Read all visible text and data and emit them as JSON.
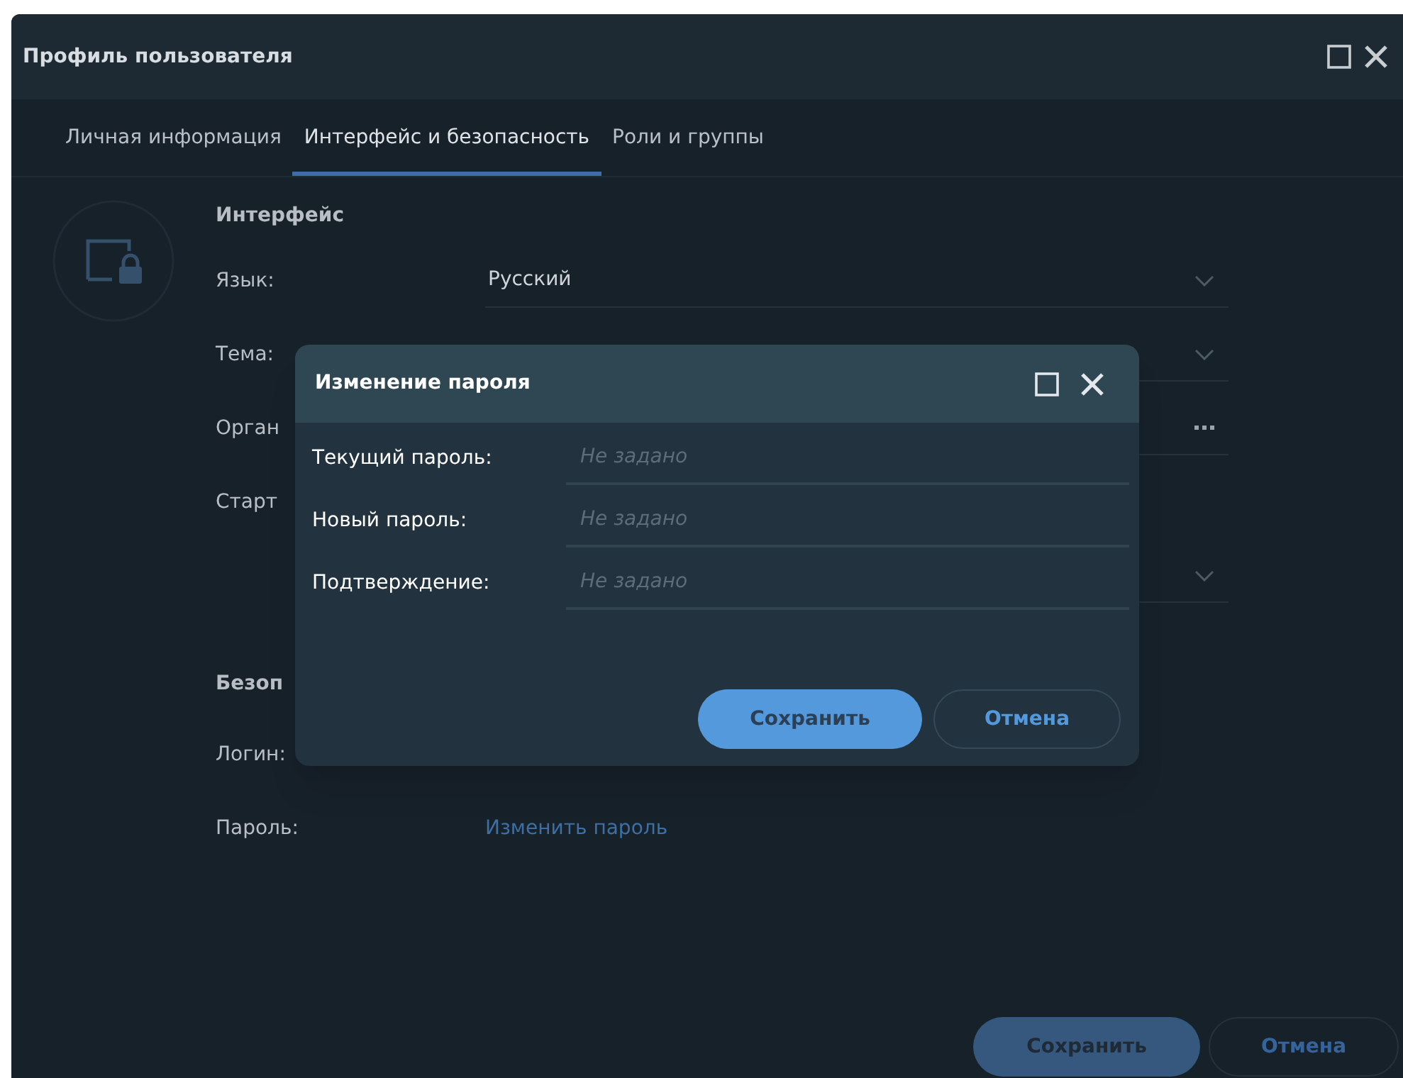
{
  "window": {
    "title": "Профиль пользователя"
  },
  "tabs": [
    {
      "label": "Личная информация",
      "selected": false
    },
    {
      "label": "Интерфейс и безопасность",
      "selected": true
    },
    {
      "label": "Роли и группы",
      "selected": false
    }
  ],
  "interface_section": {
    "heading": "Интерфейс",
    "rows": [
      {
        "label": "Язык:",
        "kind": "dropdown",
        "value": "Русский"
      },
      {
        "label": "Тема:",
        "kind": "dropdown"
      },
      {
        "label": "Орган",
        "kind": "picker"
      },
      {
        "label": "Старт",
        "kind": "none"
      },
      {
        "kind": "dropdown"
      }
    ]
  },
  "security_section": {
    "heading": "Безоп",
    "rows": [
      {
        "label": "Логин:",
        "kind": "none"
      },
      {
        "label": "Пароль:",
        "kind": "link",
        "value": "Изменить пароль"
      }
    ]
  },
  "buttons": [
    {
      "label": "Сохранить",
      "kind": "primary"
    },
    {
      "label": "Отмена",
      "kind": "secondary"
    }
  ],
  "dialog": {
    "title": "Изменение пароля",
    "fields": [
      {
        "label": "Текущий пароль:",
        "placeholder": "Не задано"
      },
      {
        "label": "Новый пароль:",
        "placeholder": "Не задано"
      },
      {
        "label": "Подтверждение:",
        "placeholder": "Не задано"
      }
    ],
    "buttons": [
      {
        "label": "Сохранить",
        "kind": "primary"
      },
      {
        "label": "Отмена",
        "kind": "secondary"
      }
    ]
  }
}
